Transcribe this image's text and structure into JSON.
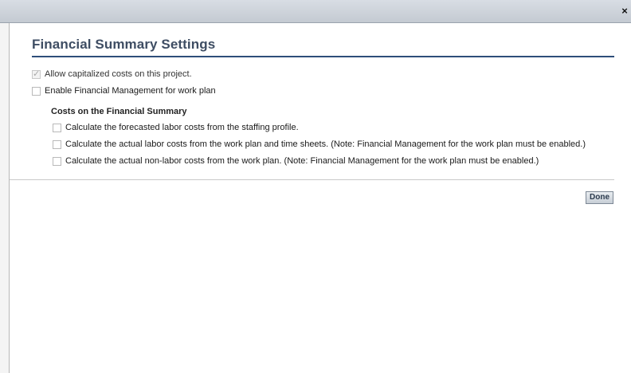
{
  "window": {
    "close_glyph": "×"
  },
  "dialog": {
    "title": "Financial Summary Settings"
  },
  "options": {
    "allow_capitalized": {
      "label": "Allow capitalized costs on this project.",
      "checked": true,
      "disabled": true
    },
    "enable_fm": {
      "label": "Enable Financial Management for work plan",
      "checked": false
    }
  },
  "costs_section": {
    "title": "Costs on the Financial Summary",
    "items": [
      {
        "label": "Calculate the forecasted labor costs from the staffing profile.",
        "checked": false
      },
      {
        "label": "Calculate the actual labor costs from the work plan and time sheets. (Note: Financial Management for the work plan must be enabled.)",
        "checked": false
      },
      {
        "label": "Calculate the actual non-labor costs from the work plan. (Note: Financial Management for the work plan must be enabled.)",
        "checked": false
      }
    ]
  },
  "footer": {
    "done_label": "Done"
  },
  "colors": {
    "title_text": "#3e4d63",
    "title_rule": "#2e4e7a",
    "titlebar": "#c4cad2"
  }
}
